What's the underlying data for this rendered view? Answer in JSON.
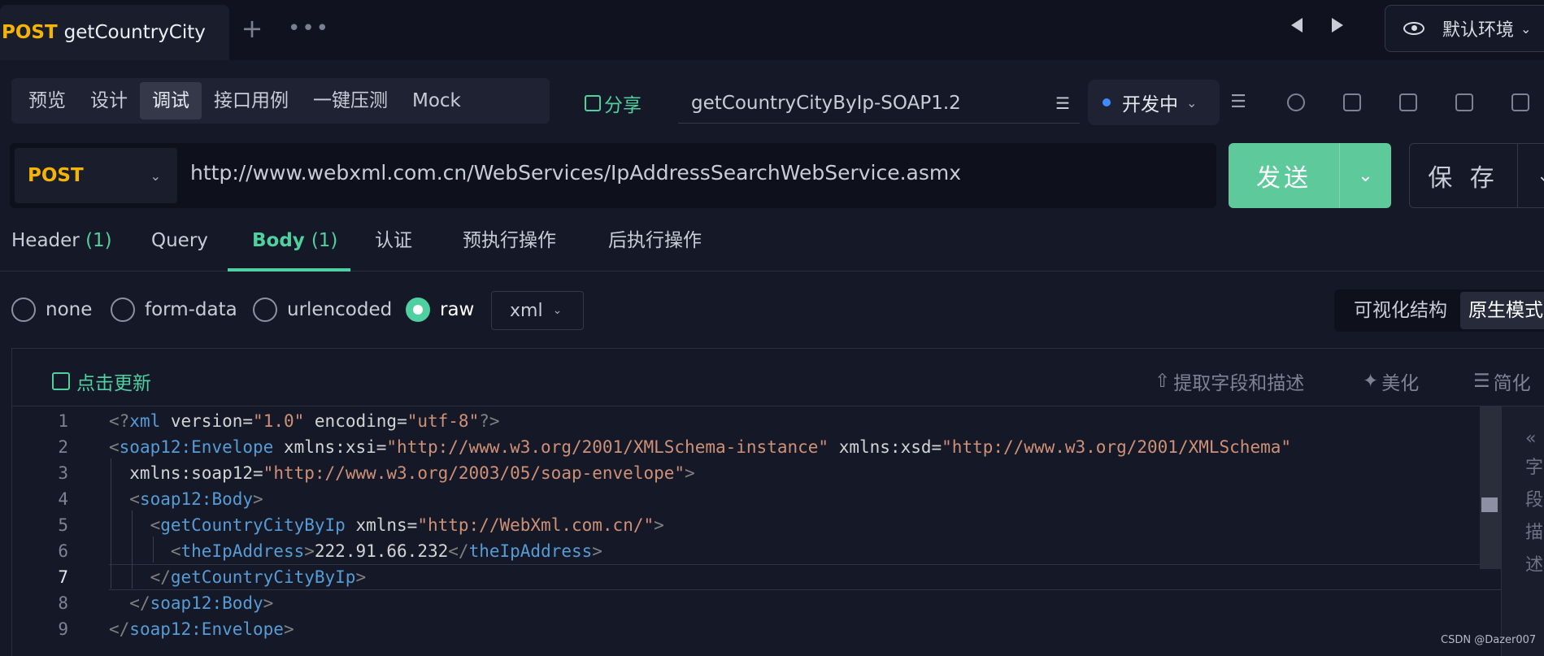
{
  "tab": {
    "method": "POST",
    "title": "getCountryCity"
  },
  "env": {
    "label": "默认环境"
  },
  "modes": [
    "预览",
    "设计",
    "调试",
    "接口用例",
    "一键压测",
    "Mock"
  ],
  "share_label": "分享",
  "api_name": "getCountryCityByIp-SOAP1.2",
  "status": {
    "label": "开发中"
  },
  "request": {
    "method": "POST",
    "url": "http://www.webxml.com.cn/WebServices/IpAddressSearchWebService.asmx",
    "send_label": "发送",
    "save_label": "保 存"
  },
  "param_tabs": [
    {
      "label": "Header",
      "count": "(1)"
    },
    {
      "label": "Query",
      "count": ""
    },
    {
      "label": "Body",
      "count": "(1)"
    },
    {
      "label": "认证",
      "count": ""
    },
    {
      "label": "预执行操作",
      "count": ""
    },
    {
      "label": "后执行操作",
      "count": ""
    }
  ],
  "body_types": [
    "none",
    "form-data",
    "urlencoded",
    "raw"
  ],
  "body_type_selected": "raw",
  "format": "xml",
  "view_toggle": [
    "可视化结构",
    "原生模式"
  ],
  "editor_toolbar": {
    "refresh": "点击更新",
    "extract": "提取字段和描述",
    "beautify": "美化",
    "simplify": "简化"
  },
  "code": {
    "line_numbers": [
      "1",
      "2",
      "3",
      "4",
      "5",
      "6",
      "7",
      "8",
      "9"
    ],
    "current_line": 7,
    "lines": [
      "<?xml version=\"1.0\" encoding=\"utf-8\"?>",
      "<soap12:Envelope xmlns:xsi=\"http://www.w3.org/2001/XMLSchema-instance\" xmlns:xsd=\"http://www.w3.org/2001/XMLSchema\"",
      "  xmlns:soap12=\"http://www.w3.org/2003/05/soap-envelope\">",
      "  <soap12:Body>",
      "    <getCountryCityByIp xmlns=\"http://WebXml.com.cn/\">",
      "      <theIpAddress>222.91.66.232</theIpAddress>",
      "    </getCountryCityByIp>",
      "  </soap12:Body>",
      "</soap12:Envelope>"
    ]
  },
  "side_panel": {
    "label": "字段描述"
  },
  "watermark": "CSDN @Dazer007",
  "colors": {
    "accent": "#4fd0a0",
    "method": "#f5b400",
    "status_dot": "#3d8cff"
  }
}
